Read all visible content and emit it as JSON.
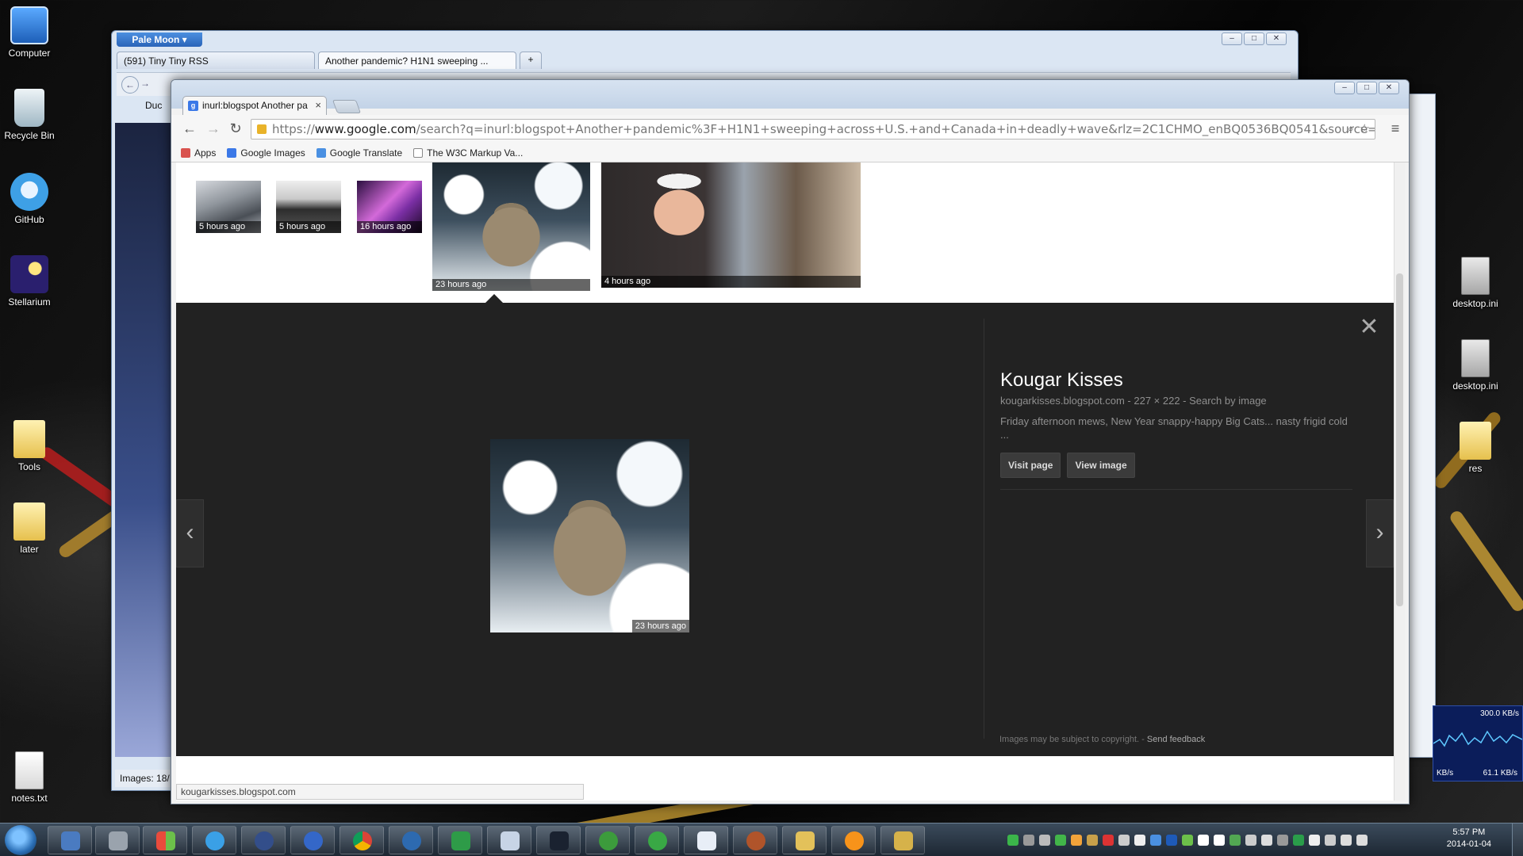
{
  "desktop": {
    "icons_left": [
      {
        "label": "Computer",
        "icon": "computer-icon"
      },
      {
        "label": "Recycle Bin",
        "icon": "recycle-bin-icon"
      },
      {
        "label": "GitHub",
        "icon": "github-icon"
      },
      {
        "label": "Stellarium",
        "icon": "stellarium-icon"
      },
      {
        "label": "Tools",
        "icon": "folder-icon"
      },
      {
        "label": "later",
        "icon": "folder-icon"
      },
      {
        "label": "notes.txt",
        "icon": "text-file-icon"
      }
    ],
    "icons_right": [
      {
        "label": "desktop.ini",
        "icon": "ini-file-icon"
      },
      {
        "label": "desktop.ini",
        "icon": "ini-file-icon"
      },
      {
        "label": "res",
        "icon": "folder-icon"
      }
    ]
  },
  "palemoon": {
    "menu_label": "Pale Moon ▾",
    "tabs": [
      {
        "label": "(591) Tiny Tiny RSS"
      },
      {
        "label": "Another pandemic? H1N1 sweeping ..."
      }
    ],
    "bookmark_partial": "Duc",
    "status_partial": "Images: 18/"
  },
  "chrome": {
    "tab_title": "inurl:blogspot Another pa",
    "url_prefix": "https://",
    "url_host": "www.google.com",
    "url_rest": "/search?q=inurl:blogspot+Another+pandemic%3F+H1N1+sweeping+across+U.S.+and+Canada+in+deadly+wave&rlz=2C1CHMO_enBQ0536BQ0541&source=lnms&t",
    "bookmarks": [
      {
        "label": "Apps",
        "color": "#d9534f"
      },
      {
        "label": "Google Images",
        "color": "#3b78e7"
      },
      {
        "label": "Google Translate",
        "color": "#4a90e2"
      },
      {
        "label": "The W3C Markup Va...",
        "color": "#ffffff"
      }
    ],
    "status_url": "kougarkisses.blogspot.com"
  },
  "results": {
    "thumbs": [
      {
        "caption": "5 hours ago"
      },
      {
        "caption": "5 hours ago"
      },
      {
        "caption": "16 hours ago"
      },
      {
        "caption": "23 hours ago"
      },
      {
        "caption": "4 hours ago"
      }
    ],
    "preview": {
      "image_caption": "23 hours ago",
      "title": "Kougar Kisses",
      "meta": "kougarkisses.blogspot.com - 227 × 222 - Search by image",
      "description": "Friday afternoon mews, New Year snappy-happy Big Cats... nasty frigid cold ...",
      "visit_label": "Visit page",
      "view_label": "View image",
      "copyright_note": "Images may be subject to copyright. -",
      "feedback_label": "Send feedback"
    }
  },
  "netmeter": {
    "upload": "300.0 KB/s",
    "left": "KB/s",
    "download": "61.1 KB/s"
  },
  "taskbar": {
    "time": "5:57 PM",
    "date": "2014-01-04"
  },
  "colors": {
    "preview_bg": "#222222",
    "accent_blue": "#3b78e7"
  }
}
